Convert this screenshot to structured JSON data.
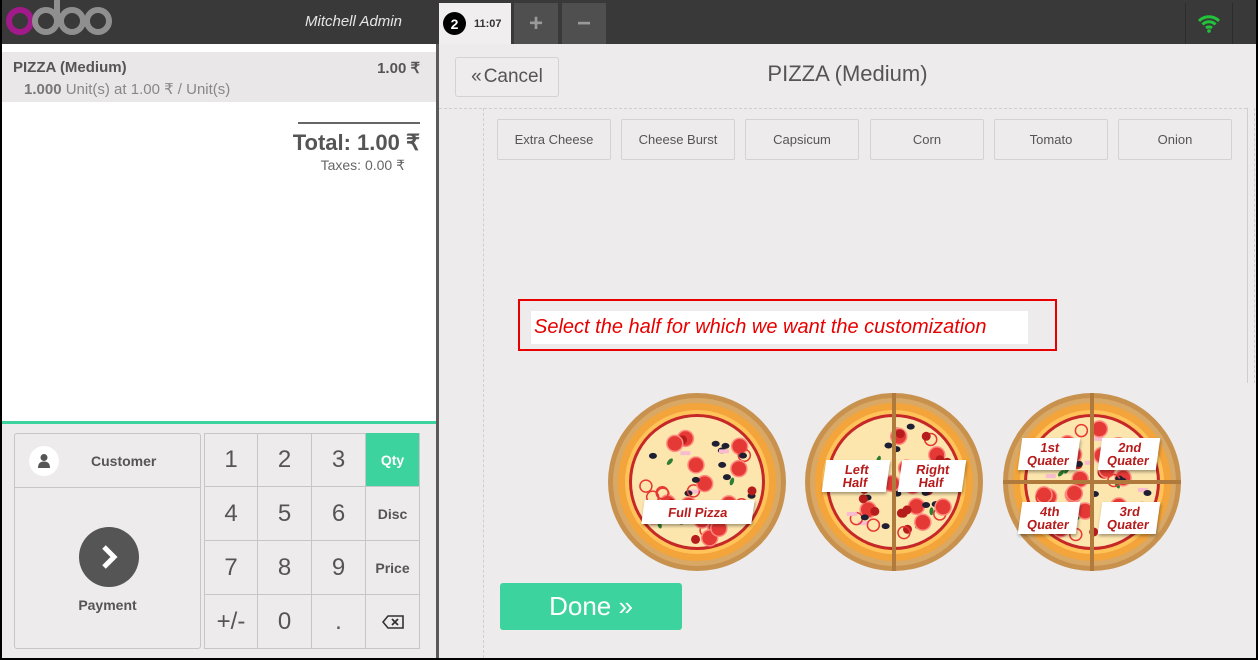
{
  "header": {
    "logo": "odoo",
    "user_name": "Mitchell Admin",
    "order_tab": {
      "number": "2",
      "time": "11:07"
    },
    "add_order_label": "+",
    "remove_order_label": "−",
    "connection_icon": "wifi-icon",
    "connection_color": "#22c33a"
  },
  "order": {
    "lines": [
      {
        "name": "PIZZA (Medium)",
        "price": "1.00 ₹",
        "qty": "1.000",
        "unit_info": "Unit(s) at 1.00 ₹ / Unit(s)"
      }
    ],
    "total": "Total: 1.00 ₹",
    "taxes": "Taxes: 0.00 ₹"
  },
  "actionpad": {
    "customer_label": "Customer",
    "payment_label": "Payment"
  },
  "numpad": {
    "keys": [
      "1",
      "2",
      "3",
      "Qty",
      "4",
      "5",
      "6",
      "Disc",
      "7",
      "8",
      "9",
      "Price",
      "+/-",
      "0",
      ".",
      "⌫"
    ],
    "selected_mode": "Qty"
  },
  "customization": {
    "cancel_label": "Cancel",
    "title": "PIZZA (Medium)",
    "toppings": [
      "Extra Cheese",
      "Cheese Burst",
      "Capsicum",
      "Corn",
      "Tomato",
      "Onion"
    ],
    "hint": "Select the half for which we want the customization",
    "pizza_options": [
      {
        "type": "full",
        "labels": [
          "Full Pizza"
        ]
      },
      {
        "type": "halves",
        "labels": [
          "Left\nHalf",
          "Right\nHalf"
        ]
      },
      {
        "type": "quarters",
        "labels": [
          "1st\nQuater",
          "2nd\nQuater",
          "4th\nQuater",
          "3rd\nQuater"
        ]
      }
    ],
    "done_label": "Done »"
  },
  "colors": {
    "accent": "#3dd39e",
    "header_bg": "#393939",
    "hint_red": "#e80000",
    "label_red": "#b71c1c"
  }
}
